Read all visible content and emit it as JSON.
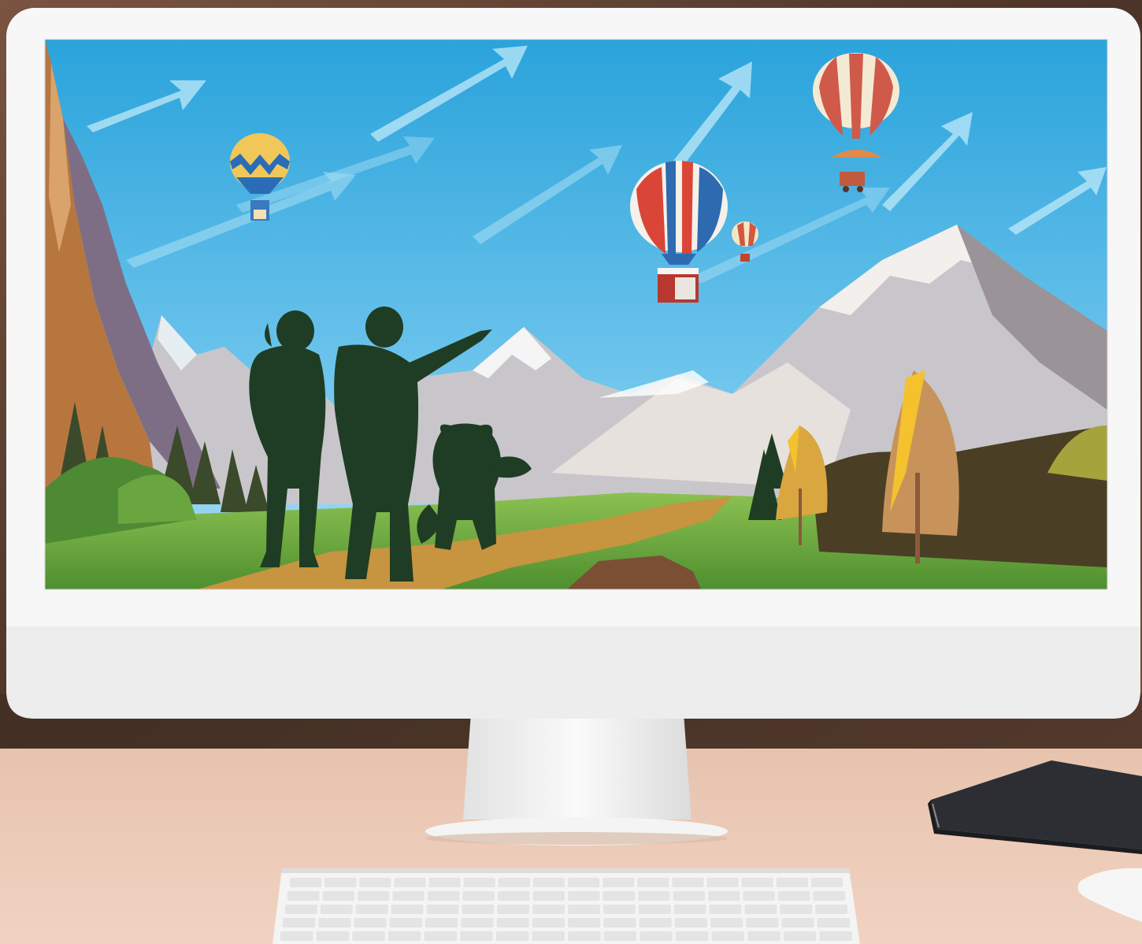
{
  "scene": {
    "description_label": "",
    "colors": {
      "sky_top": "#2aa3db",
      "sky_bottom": "#8fd3f2",
      "silhouette": "#1f3d24",
      "monitor_frame": "#f7f7f7",
      "monitor_chin": "#ededed",
      "desk": "#ecc8b4",
      "wall_dark": "#5a3f2e",
      "notebook": "#2c2e33",
      "grass": "#78b34a",
      "path": "#c7943f"
    },
    "icons": {
      "balloon_small_left": "zigzag-hot-air-balloon",
      "balloon_center": "striped-hot-air-balloon-with-shop",
      "balloon_right": "striped-hot-air-balloon-with-cart",
      "balloon_tiny": "small-hot-air-balloon"
    },
    "notebook_spine_text": "",
    "notebook_cover_text": ""
  }
}
